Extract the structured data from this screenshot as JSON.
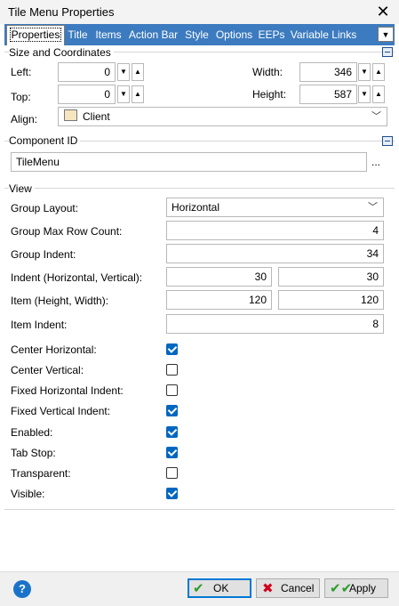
{
  "window": {
    "title": "Tile Menu Properties"
  },
  "tabs": [
    "Properties",
    "Title",
    "Items",
    "Action Bar",
    "Style",
    "Options",
    "EEPs",
    "Variable Links"
  ],
  "size_coords": {
    "group_title": "Size and Coordinates",
    "left_label": "Left:",
    "left_value": "0",
    "top_label": "Top:",
    "top_value": "0",
    "width_label": "Width:",
    "width_value": "346",
    "height_label": "Height:",
    "height_value": "587",
    "align_label": "Align:",
    "align_value": "Client"
  },
  "component": {
    "group_title": "Component ID",
    "value": "TileMenu",
    "button": "..."
  },
  "view": {
    "group_title": "View",
    "group_layout_label": "Group Layout:",
    "group_layout_value": "Horizontal",
    "max_row_label": "Group Max Row Count:",
    "max_row_value": "4",
    "group_indent_label": "Group Indent:",
    "group_indent_value": "34",
    "indent_label": "Indent (Horizontal, Vertical):",
    "indent_h": "30",
    "indent_v": "30",
    "item_label": "Item (Height, Width):",
    "item_h": "120",
    "item_w": "120",
    "item_indent_label": "Item Indent:",
    "item_indent_value": "8"
  },
  "checkboxes": [
    {
      "label": "Center Horizontal:",
      "checked": true
    },
    {
      "label": "Center Vertical:",
      "checked": false
    },
    {
      "label": "Fixed Horizontal Indent:",
      "checked": false
    },
    {
      "label": "Fixed Vertical Indent:",
      "checked": true
    },
    {
      "label": "Enabled:",
      "checked": true
    },
    {
      "label": "Tab Stop:",
      "checked": true
    },
    {
      "label": "Transparent:",
      "checked": false
    },
    {
      "label": "Visible:",
      "checked": true
    }
  ],
  "buttons": {
    "help": "?",
    "ok": "OK",
    "cancel": "Cancel",
    "apply": "Apply"
  },
  "colors": {
    "tab_strip": "#3c7bbf",
    "checkbox_on": "#0067c0",
    "ok_icon": "#2a9d2a",
    "cancel_icon": "#d0021b"
  }
}
